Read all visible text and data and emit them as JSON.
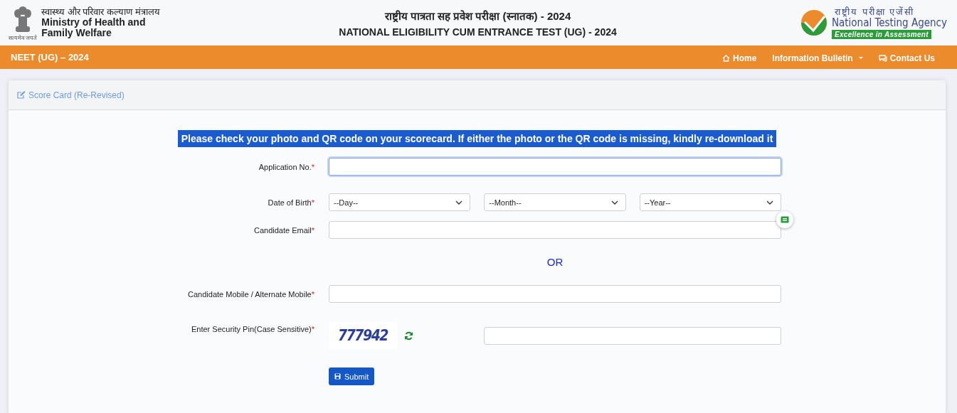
{
  "header": {
    "ministry_hindi": "स्वास्थ्य और परिवार कल्याण मंत्रालय",
    "ministry": "Ministry of Health and Family Welfare",
    "motto": "सत्यमेव जयते",
    "title_hindi": "राष्ट्रीय पात्रता सह प्रवेश परीक्षा (स्नातक) - 2024",
    "title": "NATIONAL ELIGIBILITY CUM ENTRANCE TEST (UG) - 2024",
    "agency_hindi": "राष्ट्रीय परीक्षा एजेंसी",
    "agency": "National Testing Agency",
    "agency_tagline": "Excellence in Assessment"
  },
  "navbar": {
    "brand": "NEET (UG) – 2024",
    "items": [
      {
        "label": "Home",
        "dropdown": false
      },
      {
        "label": "Information Bulletin",
        "dropdown": true
      },
      {
        "label": "Contact Us",
        "dropdown": false
      }
    ]
  },
  "card": {
    "title": "Score Card (Re-Revised)",
    "banner": "Please check your photo and QR code on your scorecard. If either the photo or the QR code is missing, kindly re-download it",
    "fields": [
      {
        "kind": "text",
        "label": "Application No.",
        "mark": "*",
        "focused": true
      },
      {
        "kind": "selects",
        "label": "Date of Birth",
        "mark": "*",
        "selects": [
          "--Day--",
          "--Month--",
          "--Year--"
        ]
      },
      {
        "kind": "text",
        "label": "Candidate Email",
        "mark": "*",
        "focused": false
      },
      {
        "kind": "separator",
        "text": "OR"
      },
      {
        "kind": "text",
        "label": "Candidate Mobile / Alternate Mobile",
        "mark": "*",
        "focused": false
      },
      {
        "kind": "captcha",
        "label": "Enter Security Pin(Case Sensitive)",
        "mark": "*",
        "code": "777942"
      }
    ],
    "submit": "Submit"
  }
}
